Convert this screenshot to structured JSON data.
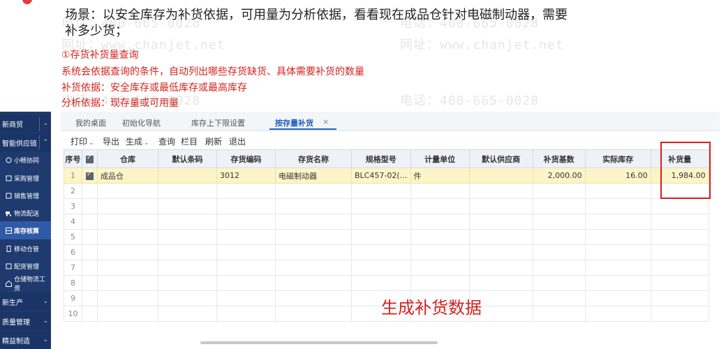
{
  "scenario": {
    "line1": "场景：以安全库存为补货依据，可用量为分析依据，看看现在成品仓针对电磁制动器，需要",
    "line2": "补多少货；"
  },
  "notes": [
    "①存货补货量查询",
    "系统会依据查询的条件，自动列出哪些存货缺货、具体需要补货的数量",
    "补货依据：安全库存或最低库存或最高库存",
    "分析依据：现存量或可用量"
  ],
  "watermarks": {
    "phone": "电话：400-665-0028",
    "site": "网址：www.chanjet.net"
  },
  "sidebar": {
    "items": [
      {
        "label": "新商贸",
        "icon": "store-icon"
      },
      {
        "label": "智能供应链",
        "icon": "chain-icon"
      },
      {
        "label": "小畅协同",
        "icon": "collab-icon"
      },
      {
        "label": "采购管理",
        "icon": "purchase-icon"
      },
      {
        "label": "销售管理",
        "icon": "sales-icon"
      },
      {
        "label": "物流配送",
        "icon": "truck-icon"
      },
      {
        "label": "库存核算",
        "icon": "inventory-icon"
      },
      {
        "label": "移动仓管",
        "icon": "mobile-icon"
      },
      {
        "label": "配货管理",
        "icon": "distribution-icon"
      },
      {
        "label": "仓储物流工资",
        "icon": "warehouse-icon"
      },
      {
        "label": "新生产",
        "icon": "production-icon"
      },
      {
        "label": "质量管理",
        "icon": "quality-icon"
      },
      {
        "label": "精益制造",
        "icon": "manufacture-icon"
      }
    ]
  },
  "tabs": [
    "我的桌面",
    "初始化导航",
    "库存上下限设置",
    "按存量补货"
  ],
  "active_tab": "按存量补货",
  "toolbar": {
    "print": "打印",
    "export": "导出",
    "generate": "生成",
    "query": "查询",
    "columns": "栏目",
    "refresh": "刷新",
    "exit": "退出"
  },
  "table": {
    "headers": [
      "序号",
      "",
      "仓库",
      "默认条码",
      "存货编码",
      "存货名称",
      "规格型号",
      "计量单位",
      "默认供应商",
      "补货基数",
      "实际库存",
      "补货量"
    ],
    "rows": [
      {
        "no": "1",
        "checked": true,
        "warehouse": "成品仓",
        "barcode": "",
        "code": "3012",
        "name": "电磁制动器",
        "spec": "BLC457-02(…",
        "unit": "件",
        "supplier": "",
        "base": "2,000.00",
        "stock": "16.00",
        "qty": "1,984.00"
      }
    ],
    "empty_row_numbers": [
      "2",
      "3",
      "4",
      "5",
      "6",
      "7",
      "8",
      "9",
      "10"
    ]
  },
  "caption": "生成补货数据",
  "colors": {
    "accent": "#1f5fbf",
    "sidebar": "#1e3a6e",
    "highlight": "#d81e1e",
    "note_red": "#d4231d",
    "selected_row": "#fdf5c8"
  }
}
